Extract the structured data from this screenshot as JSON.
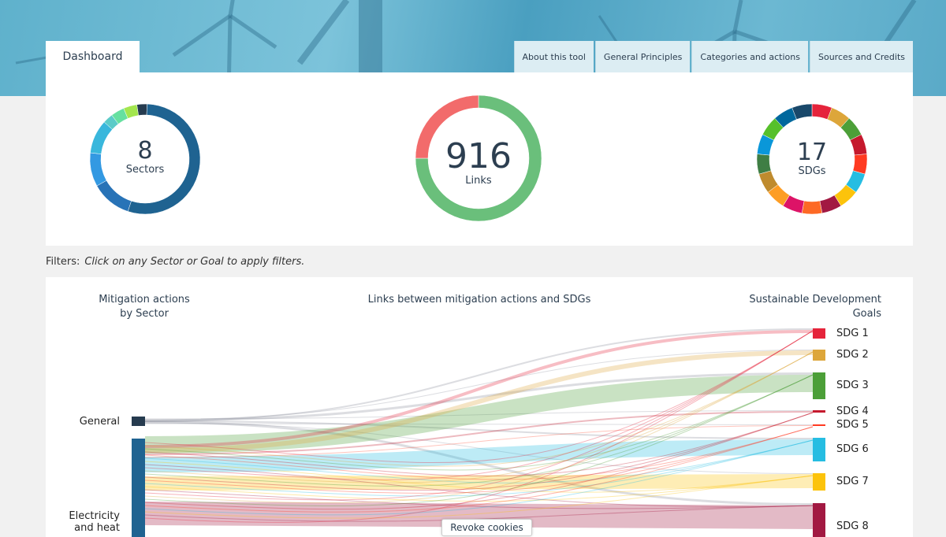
{
  "header": {
    "active_tab": "Dashboard",
    "tabs": [
      "About this tool",
      "General Principles",
      "Categories and actions",
      "Sources and Credits"
    ]
  },
  "summary": {
    "sectors": {
      "count": "8",
      "label": "Sectors",
      "segments": [
        {
          "color": "#263b4f",
          "value": 3
        },
        {
          "color": "#1f6391",
          "value": 55
        },
        {
          "color": "#2873b7",
          "value": 12
        },
        {
          "color": "#3399e2",
          "value": 10
        },
        {
          "color": "#39b7dc",
          "value": 10
        },
        {
          "color": "#5bcbc8",
          "value": 3
        },
        {
          "color": "#66e0a0",
          "value": 4
        },
        {
          "color": "#a3e64e",
          "value": 4
        }
      ]
    },
    "links": {
      "count": "916",
      "label": "Links",
      "segments": [
        {
          "color": "#6abf7b",
          "value": 75
        },
        {
          "color": "#f26b6b",
          "value": 25
        }
      ]
    },
    "sdgs": {
      "count": "17",
      "label": "SDGs"
    }
  },
  "sdg_colors": [
    "#e5243b",
    "#dda63a",
    "#4c9f38",
    "#c5192d",
    "#ff3a21",
    "#26bde2",
    "#fcc30b",
    "#a21942",
    "#fd6925",
    "#dd1367",
    "#fd9d24",
    "#bf8b2e",
    "#3f7e44",
    "#0a97d9",
    "#56c02b",
    "#00689d",
    "#19486a"
  ],
  "filters": {
    "label": "Filters:",
    "hint": "Click on any Sector or Goal to apply filters."
  },
  "sankey": {
    "left_title": "Mitigation actions\nby Sector",
    "center_title": "Links between mitigation actions and SDGs",
    "right_title": "Sustainable Development\nGoals",
    "sectors": [
      {
        "label": "General",
        "color": "#263b4f"
      },
      {
        "label": "Electricity\nand heat",
        "color": "#1f6391"
      }
    ],
    "goals": [
      "SDG 1",
      "SDG 2",
      "SDG 3",
      "SDG 4",
      "SDG 5",
      "SDG 6",
      "SDG 7",
      "SDG 8"
    ]
  },
  "cookies": {
    "label": "Revoke cookies"
  }
}
